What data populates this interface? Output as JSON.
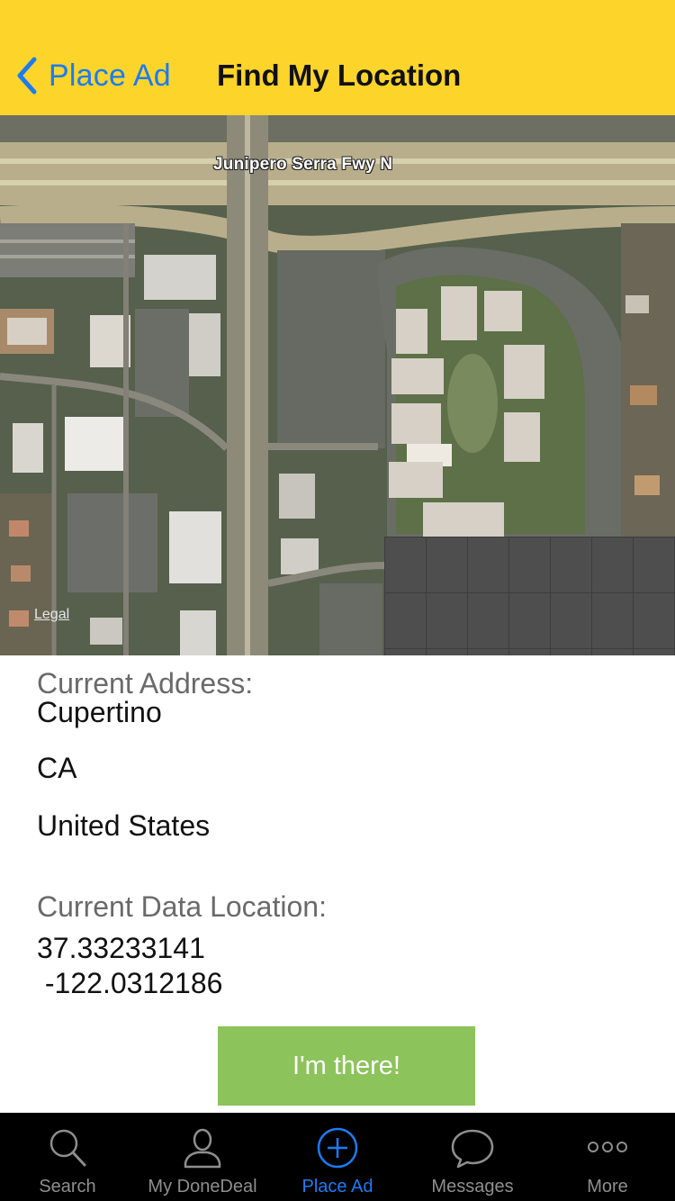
{
  "nav": {
    "back_label": "Place Ad",
    "title": "Find My Location"
  },
  "map": {
    "road_label": "Junipero Serra Fwy N",
    "legal_label": "Legal"
  },
  "address": {
    "heading": "Current Address:",
    "city": "Cupertino",
    "state": "CA",
    "country": "United States"
  },
  "location": {
    "heading": "Current Data Location:",
    "latitude": "37.33233141",
    "longitude": " -122.0312186"
  },
  "confirm_button_label": "I'm there!",
  "tabs": [
    {
      "label": "Search",
      "icon": "search-icon"
    },
    {
      "label": "My DoneDeal",
      "icon": "person-icon"
    },
    {
      "label": "Place Ad",
      "icon": "plus-circle-icon",
      "active": true
    },
    {
      "label": "Messages",
      "icon": "chat-bubble-icon"
    },
    {
      "label": "More",
      "icon": "more-dots-icon"
    }
  ],
  "colors": {
    "navbar": "#fcd42a",
    "accent_blue": "#1a7cf5",
    "button_green": "#8cc35a",
    "tabbar": "#000000"
  }
}
